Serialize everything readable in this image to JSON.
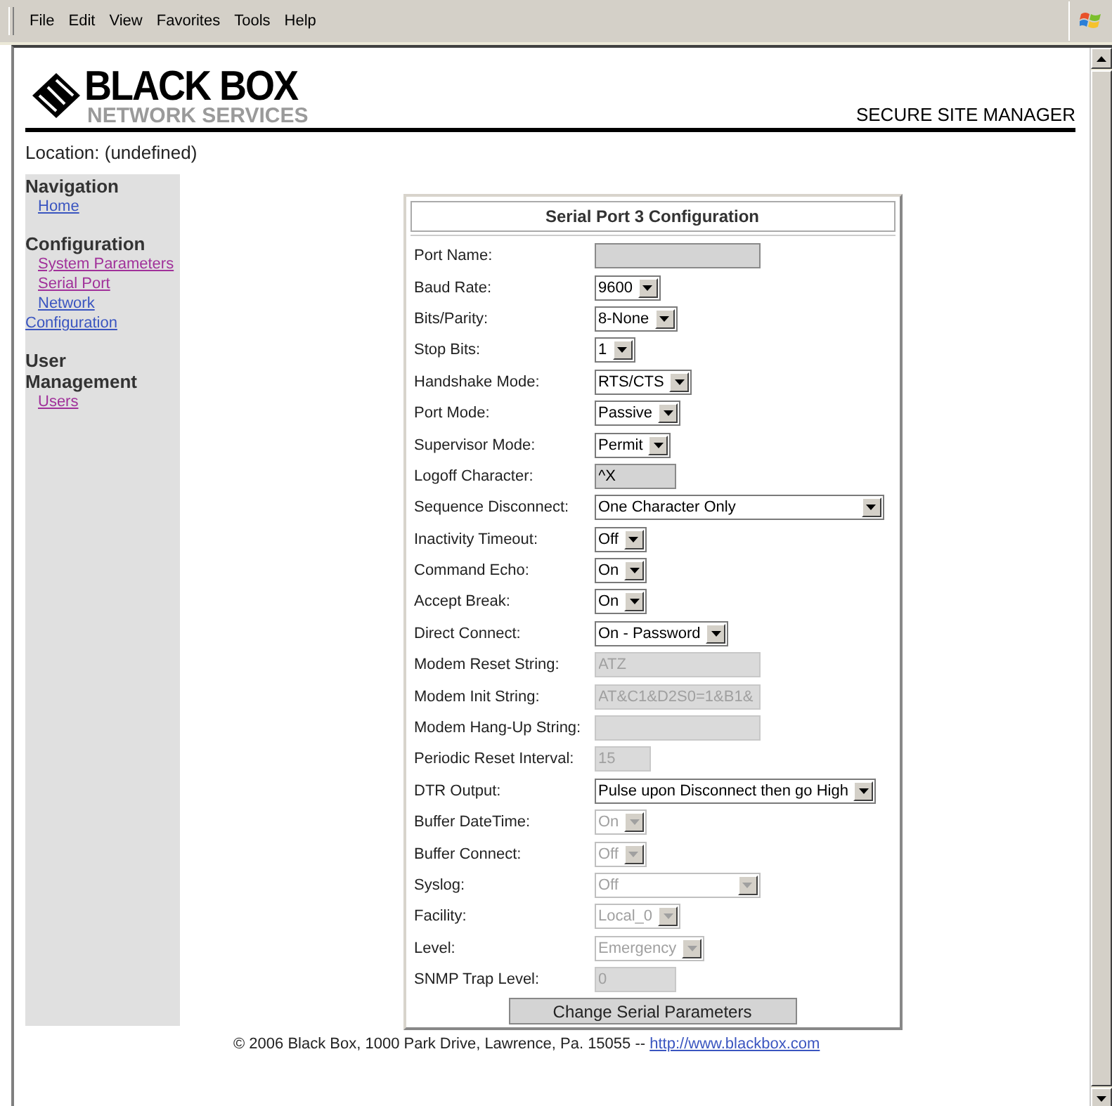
{
  "menu_bar": [
    "File",
    "Edit",
    "View",
    "Favorites",
    "Tools",
    "Help"
  ],
  "header": {
    "logo_title": "BLACK BOX",
    "logo_subtitle": "NETWORK SERVICES",
    "product": "SECURE SITE MANAGER"
  },
  "location": "Location: (undefined)",
  "sidebar": [
    {
      "heading": "Navigation",
      "links": [
        {
          "label": "Home",
          "visited": false
        }
      ]
    },
    {
      "heading": "Configuration",
      "links": [
        {
          "label": "System Parameters",
          "visited": true
        },
        {
          "label": "Serial Port",
          "visited": true
        },
        {
          "label": "Network Configuration",
          "visited": false
        }
      ]
    },
    {
      "heading": "User Management",
      "links": [
        {
          "label": "Users",
          "visited": true
        }
      ]
    }
  ],
  "form": {
    "title": "Serial Port 3 Configuration",
    "fields": [
      {
        "label": "Port Name:",
        "kind": "text",
        "disabled": false
      },
      {
        "label": "Baud Rate:",
        "kind": "select",
        "value": "9600",
        "disabled": false
      },
      {
        "label": "Bits/Parity:",
        "kind": "select",
        "value": "8-None",
        "disabled": false
      },
      {
        "label": "Stop Bits:",
        "kind": "select",
        "value": "1",
        "disabled": false
      },
      {
        "label": "Handshake Mode:",
        "kind": "select",
        "value": "RTS/CTS",
        "disabled": false
      },
      {
        "label": "Port Mode:",
        "kind": "select",
        "value": "Passive",
        "disabled": false
      },
      {
        "label": "Supervisor Mode:",
        "kind": "select",
        "value": "Permit",
        "disabled": false
      },
      {
        "label": "Logoff Character:",
        "kind": "short_text",
        "value": "^X",
        "disabled": false
      },
      {
        "label": "Sequence Disconnect:",
        "kind": "wide_select",
        "value": "One Character Only",
        "disabled": false
      },
      {
        "label": "Inactivity Timeout:",
        "kind": "select",
        "value": "Off",
        "disabled": false
      },
      {
        "label": "Command Echo:",
        "kind": "select",
        "value": "On",
        "disabled": false
      },
      {
        "label": "Accept Break:",
        "kind": "select",
        "value": "On",
        "disabled": false
      },
      {
        "label": "Direct Connect:",
        "kind": "select",
        "value": "On - Password",
        "disabled": false
      },
      {
        "label": "Modem Reset String:",
        "kind": "text",
        "value": "ATZ",
        "disabled": true
      },
      {
        "label": "Modem Init String:",
        "kind": "text",
        "value": "AT&C1&D2S0=1&B1&",
        "disabled": true
      },
      {
        "label": "Modem Hang-Up String:",
        "kind": "text",
        "disabled": true
      },
      {
        "label": "Periodic Reset Interval:",
        "kind": "tiny_text",
        "value": "15",
        "disabled": true
      },
      {
        "label": "DTR Output:",
        "kind": "select",
        "value": "Pulse upon Disconnect then go High",
        "disabled": false
      },
      {
        "label": "Buffer DateTime:",
        "kind": "select",
        "value": "On",
        "disabled": true
      },
      {
        "label": "Buffer Connect:",
        "kind": "select",
        "value": "Off",
        "disabled": true
      },
      {
        "label": "Syslog:",
        "kind": "mid_select",
        "value": "Off",
        "disabled": true
      },
      {
        "label": "Facility:",
        "kind": "select",
        "value": "Local_0",
        "disabled": true
      },
      {
        "label": "Level:",
        "kind": "select",
        "value": "Emergency",
        "disabled": true
      },
      {
        "label": "SNMP Trap Level:",
        "kind": "short_text",
        "value": "0",
        "disabled": true
      }
    ],
    "submit": "Change Serial Parameters"
  },
  "footer": {
    "text": "© 2006 Black Box, 1000 Park Drive, Lawrence, Pa. 15055 --",
    "link": "http://www.blackbox.com"
  }
}
